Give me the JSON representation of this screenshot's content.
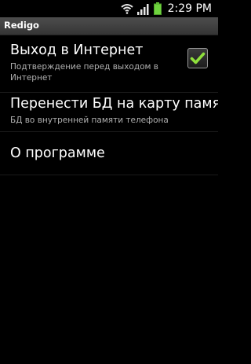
{
  "status_bar": {
    "time": "2:29 PM",
    "icons": [
      "wifi-icon",
      "signal-icon",
      "battery-icon"
    ],
    "battery_color": "#6fd33e"
  },
  "app": {
    "title": "Redigo"
  },
  "preferences": [
    {
      "title": "Выход в Интернет",
      "summary": "Подтверждение перед выходом в Интернет",
      "checked": true
    },
    {
      "title": "Перенести БД на карту памяти",
      "summary": "БД во внутренней памяти телефона"
    },
    {
      "title": "О программе"
    }
  ],
  "colors": {
    "background": "#000000",
    "check_mark": "#8fe03c",
    "title_bar": "#424242"
  }
}
